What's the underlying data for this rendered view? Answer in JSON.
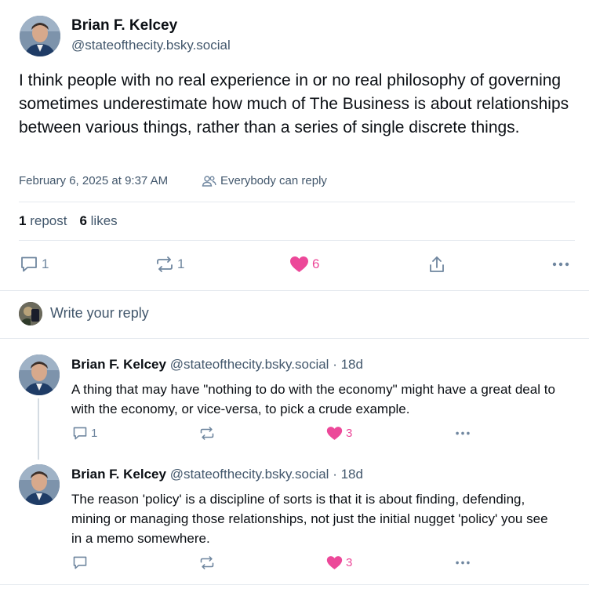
{
  "post": {
    "author_name": "Brian F. Kelcey",
    "author_handle": "@stateofthecity.bsky.social",
    "text": "I think people with no real experience in or no real philosophy of governing sometimes underestimate how much of The Business is about relationships between various things, rather than a series of single discrete things.",
    "timestamp": "February 6, 2025 at 9:37 AM",
    "reply_setting": "Everybody can reply",
    "repost_count": "1",
    "repost_label": "repost",
    "like_count": "6",
    "like_label": "likes",
    "actions": {
      "reply_count": "1",
      "repost_count": "1",
      "like_count": "6"
    }
  },
  "composer": {
    "placeholder": "Write your reply"
  },
  "replies": [
    {
      "author_name": "Brian F. Kelcey",
      "author_handle": "@stateofthecity.bsky.social",
      "age": "· 18d",
      "text": "A thing that may have \"nothing to do with the economy\" might have a great deal to with the economy, or vice-versa, to pick a crude example.",
      "reply_count": "1",
      "like_count": "3"
    },
    {
      "author_name": "Brian F. Kelcey",
      "author_handle": "@stateofthecity.bsky.social",
      "age": "· 18d",
      "text": "The reason 'policy' is a discipline of sorts is that it is about finding, defending, mining or managing those relationships, not just the initial nugget 'policy' you see in a memo somewhere.",
      "reply_count": "",
      "like_count": "3"
    }
  ],
  "colors": {
    "like_pink": "#ec4899",
    "muted_text": "#42576c",
    "divider": "#e4e9ee"
  }
}
